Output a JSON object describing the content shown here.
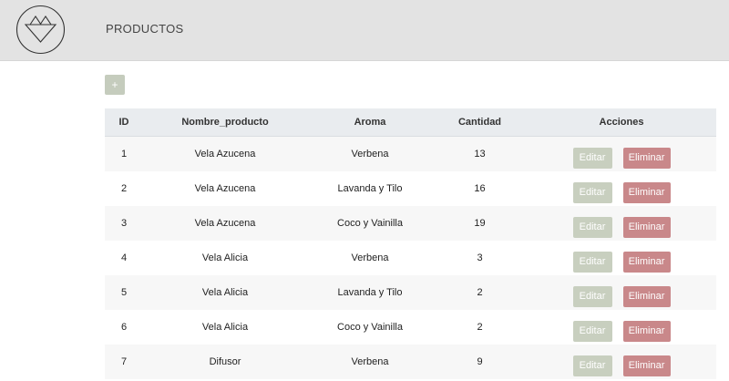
{
  "header": {
    "title": "PRODUCTOS",
    "logo_icon": "geometric-triangles-logo-icon"
  },
  "toolbar": {
    "add_label": "+"
  },
  "table": {
    "columns": [
      "ID",
      "Nombre_producto",
      "Aroma",
      "Cantidad",
      "Acciones"
    ],
    "rows": [
      {
        "id": "1",
        "name": "Vela Azucena",
        "aroma": "Verbena",
        "qty": "13"
      },
      {
        "id": "2",
        "name": "Vela Azucena",
        "aroma": "Lavanda y Tilo",
        "qty": "16"
      },
      {
        "id": "3",
        "name": "Vela Azucena",
        "aroma": "Coco y Vainilla",
        "qty": "19"
      },
      {
        "id": "4",
        "name": "Vela Alicia",
        "aroma": "Verbena",
        "qty": "3"
      },
      {
        "id": "5",
        "name": "Vela Alicia",
        "aroma": "Lavanda y Tilo",
        "qty": "2"
      },
      {
        "id": "6",
        "name": "Vela Alicia",
        "aroma": "Coco y Vainilla",
        "qty": "2"
      },
      {
        "id": "7",
        "name": "Difusor",
        "aroma": "Verbena",
        "qty": "9"
      }
    ],
    "edit_label": "Editar",
    "delete_label": "Eliminar"
  },
  "colors": {
    "header_bg": "#e3e3e3",
    "edit_button": "#c8cfbf",
    "delete_button": "#c9888a",
    "add_button": "#c5ccbd"
  }
}
